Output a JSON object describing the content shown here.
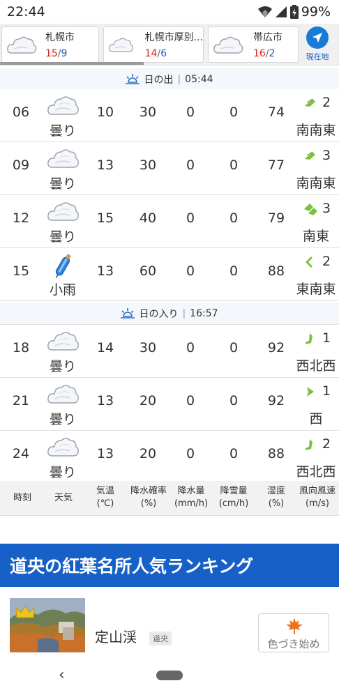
{
  "status_bar": {
    "time": "22:44",
    "battery": "99%"
  },
  "cities": [
    {
      "name": "札幌市",
      "high": "15",
      "sep": "/",
      "low": "9"
    },
    {
      "name": "札幌市厚別...",
      "high": "14",
      "sep": "/",
      "low": "6"
    },
    {
      "name": "帯広市",
      "high": "16",
      "sep": "/",
      "low": "2"
    }
  ],
  "current_location_label": "現在地",
  "sunrise": {
    "label": "日の出",
    "time": "05:44"
  },
  "sunset": {
    "label": "日の入り",
    "time": "16:57"
  },
  "hours": [
    {
      "time": "06",
      "weather": "曇り",
      "icon": "cloud-icon",
      "temp": "10",
      "precip_prob": "30",
      "precip_mm": "0",
      "snow_cm": "0",
      "humidity": "74",
      "wind_speed": "2",
      "wind_dir": "南南東",
      "wind_icon": "wind-arrow-icon"
    },
    {
      "time": "09",
      "weather": "曇り",
      "icon": "cloud-icon",
      "temp": "13",
      "precip_prob": "30",
      "precip_mm": "0",
      "snow_cm": "0",
      "humidity": "77",
      "wind_speed": "3",
      "wind_dir": "南南東",
      "wind_icon": "wind-arrow-icon"
    },
    {
      "time": "12",
      "weather": "曇り",
      "icon": "cloud-icon",
      "temp": "15",
      "precip_prob": "40",
      "precip_mm": "0",
      "snow_cm": "0",
      "humidity": "79",
      "wind_speed": "3",
      "wind_dir": "南東",
      "wind_icon": "wind-arrow-icon"
    },
    {
      "time": "15",
      "weather": "小雨",
      "icon": "umbrella-icon",
      "temp": "13",
      "precip_prob": "60",
      "precip_mm": "0",
      "snow_cm": "0",
      "humidity": "88",
      "wind_speed": "2",
      "wind_dir": "東南東",
      "wind_icon": "wind-arrow-icon"
    },
    {
      "time": "18",
      "weather": "曇り",
      "icon": "cloud-icon",
      "temp": "14",
      "precip_prob": "30",
      "precip_mm": "0",
      "snow_cm": "0",
      "humidity": "92",
      "wind_speed": "1",
      "wind_dir": "西北西",
      "wind_icon": "wind-arrow-icon"
    },
    {
      "time": "21",
      "weather": "曇り",
      "icon": "cloud-icon",
      "temp": "13",
      "precip_prob": "20",
      "precip_mm": "0",
      "snow_cm": "0",
      "humidity": "92",
      "wind_speed": "1",
      "wind_dir": "西",
      "wind_icon": "wind-arrow-icon"
    },
    {
      "time": "24",
      "weather": "曇り",
      "icon": "cloud-icon",
      "temp": "13",
      "precip_prob": "20",
      "precip_mm": "0",
      "snow_cm": "0",
      "humidity": "88",
      "wind_speed": "2",
      "wind_dir": "西北西",
      "wind_icon": "wind-arrow-icon"
    }
  ],
  "legend": {
    "time": "時刻",
    "weather": "天気",
    "temp": [
      "気温",
      "(℃)"
    ],
    "precip_prob": [
      "降水確率",
      "(%)"
    ],
    "precip_mm": [
      "降水量",
      "(mm/h)"
    ],
    "snow_cm": [
      "降雪量",
      "(cm/h)"
    ],
    "humidity": [
      "湿度",
      "(%)"
    ],
    "wind": [
      "風向風速",
      "(m/s)"
    ]
  },
  "ranking": {
    "title": "道央の紅葉名所人気ランキング",
    "spot": {
      "name": "定山渓",
      "region": "道央",
      "status": "色づき始め",
      "icon": "maple-leaf-icon",
      "badge_icon": "crown-icon"
    }
  },
  "colors": {
    "accent": "#1660c8",
    "temp_high": "#e02020",
    "temp_low": "#1a5ec0",
    "wind_arrow": "#7cc13a"
  }
}
